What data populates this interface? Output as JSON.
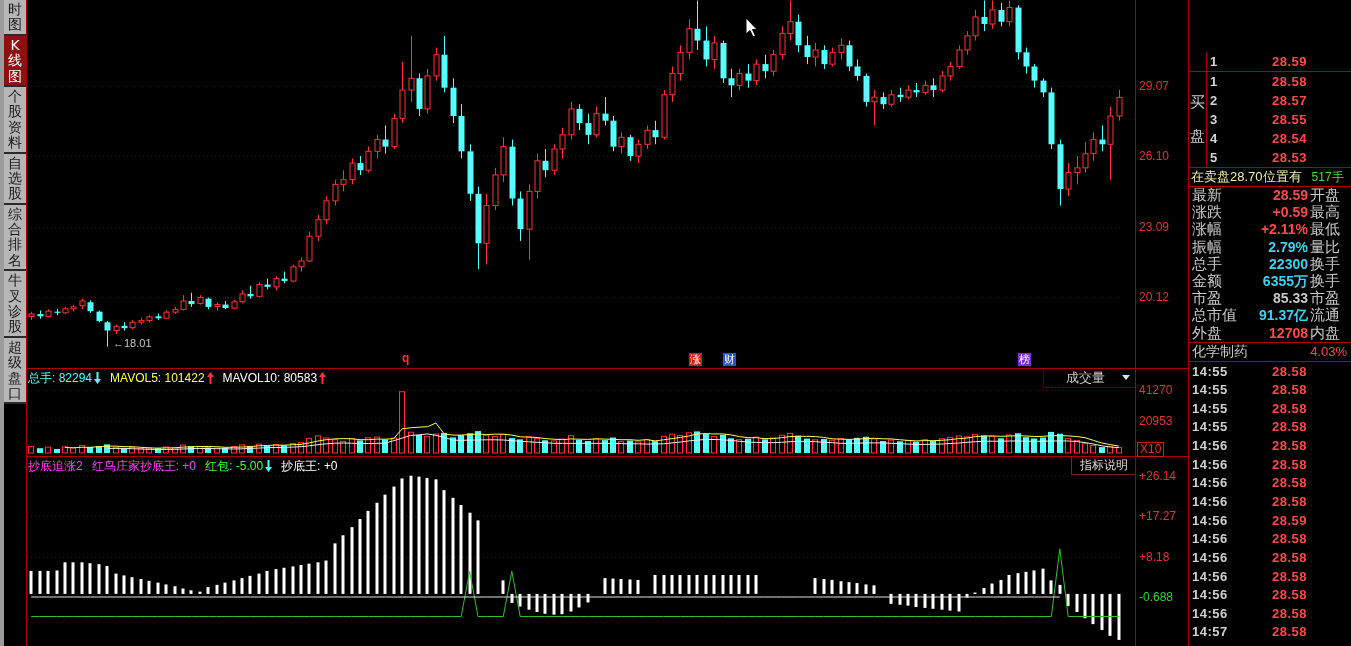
{
  "sidebar": {
    "tabs": [
      {
        "label": "时图",
        "selected": false
      },
      {
        "label": "K线图",
        "selected": true
      },
      {
        "label": "个股资料",
        "selected": false
      },
      {
        "label": "自选股",
        "selected": false
      },
      {
        "label": "综合排名",
        "selected": false
      },
      {
        "label": "牛叉诊股",
        "selected": false
      },
      {
        "label": "超级盘口",
        "selected": false
      }
    ]
  },
  "price_chart": {
    "chart_data": {
      "type": "candlestick",
      "grid": true,
      "ylim": [
        17.11,
        32.72
      ],
      "yticks": [
        {
          "value": 29.07,
          "label": "29.07"
        },
        {
          "value": 26.1,
          "label": "26.10"
        },
        {
          "value": 23.09,
          "label": "23.09"
        },
        {
          "value": 20.12,
          "label": "20.12"
        }
      ],
      "ohlc": [
        [
          19.3,
          19.5,
          19.15,
          19.4
        ],
        [
          19.4,
          19.55,
          19.2,
          19.3
        ],
        [
          19.3,
          19.6,
          19.25,
          19.52
        ],
        [
          19.5,
          19.62,
          19.35,
          19.45
        ],
        [
          19.45,
          19.7,
          19.4,
          19.62
        ],
        [
          19.62,
          19.8,
          19.5,
          19.7
        ],
        [
          19.75,
          20.05,
          19.6,
          19.95
        ],
        [
          19.9,
          19.98,
          19.45,
          19.52
        ],
        [
          19.5,
          19.55,
          19.05,
          19.1
        ],
        [
          19.05,
          19.1,
          18.01,
          18.7
        ],
        [
          18.7,
          18.95,
          18.55,
          18.88
        ],
        [
          18.9,
          19.05,
          18.7,
          18.8
        ],
        [
          18.82,
          19.15,
          18.75,
          19.05
        ],
        [
          19.05,
          19.25,
          18.95,
          19.12
        ],
        [
          19.12,
          19.35,
          19.05,
          19.28
        ],
        [
          19.3,
          19.42,
          19.15,
          19.22
        ],
        [
          19.22,
          19.55,
          19.18,
          19.48
        ],
        [
          19.48,
          19.7,
          19.4,
          19.6
        ],
        [
          19.6,
          20.2,
          19.55,
          19.95
        ],
        [
          19.95,
          20.3,
          19.7,
          19.82
        ],
        [
          19.85,
          20.2,
          19.8,
          20.1
        ],
        [
          20.05,
          20.1,
          19.6,
          19.7
        ],
        [
          19.72,
          19.9,
          19.55,
          19.8
        ],
        [
          19.8,
          19.95,
          19.6,
          19.65
        ],
        [
          19.65,
          20,
          19.6,
          19.92
        ],
        [
          19.92,
          20.4,
          19.85,
          20.25
        ],
        [
          20.25,
          20.6,
          20.05,
          20.15
        ],
        [
          20.15,
          20.75,
          20.1,
          20.65
        ],
        [
          20.65,
          20.9,
          20.45,
          20.55
        ],
        [
          20.55,
          21,
          20.4,
          20.9
        ],
        [
          20.9,
          21.2,
          20.7,
          20.8
        ],
        [
          20.8,
          21.5,
          20.75,
          21.4
        ],
        [
          21.4,
          21.8,
          21.2,
          21.65
        ],
        [
          21.65,
          22.9,
          21.6,
          22.7
        ],
        [
          22.7,
          23.6,
          22.5,
          23.4
        ],
        [
          23.4,
          24.4,
          23.2,
          24.2
        ],
        [
          24.2,
          25.1,
          24,
          24.9
        ],
        [
          24.9,
          25.5,
          24.6,
          25.1
        ],
        [
          25.1,
          26,
          24.9,
          25.8
        ],
        [
          25.8,
          26.1,
          25.3,
          25.5
        ],
        [
          25.5,
          26.5,
          25.4,
          26.3
        ],
        [
          26.3,
          27,
          26,
          26.8
        ],
        [
          26.8,
          27.4,
          26.2,
          26.5
        ],
        [
          26.5,
          27.9,
          26.4,
          27.7
        ],
        [
          27.7,
          30.1,
          27.5,
          28.9
        ],
        [
          28.9,
          31.2,
          28.4,
          29.4
        ],
        [
          29.4,
          29.6,
          27.8,
          28.1
        ],
        [
          28.1,
          29.8,
          27.9,
          29.5
        ],
        [
          29.5,
          30.7,
          29.3,
          30.4
        ],
        [
          30.4,
          31.2,
          28.8,
          29
        ],
        [
          29,
          29.4,
          27.5,
          27.8
        ],
        [
          27.8,
          28.3,
          26,
          26.3
        ],
        [
          26.3,
          26.6,
          24.2,
          24.5
        ],
        [
          24.5,
          24.8,
          21.3,
          22.4
        ],
        [
          22.4,
          24.5,
          21.5,
          24
        ],
        [
          24,
          25.6,
          23.8,
          25.3
        ],
        [
          25.3,
          26.9,
          25,
          26.5
        ],
        [
          26.5,
          26.8,
          24,
          24.3
        ],
        [
          24.3,
          24.6,
          22.5,
          23
        ],
        [
          23,
          24.9,
          21.7,
          24.6
        ],
        [
          24.6,
          26.2,
          24.3,
          25.9
        ],
        [
          25.9,
          26.4,
          25.2,
          25.5
        ],
        [
          25.5,
          26.6,
          25.3,
          26.4
        ],
        [
          26.4,
          27.3,
          26,
          27
        ],
        [
          27,
          28.4,
          26.8,
          28.1
        ],
        [
          28.1,
          28.3,
          27.2,
          27.5
        ],
        [
          27.5,
          27.9,
          26.6,
          27
        ],
        [
          27,
          28.2,
          26.9,
          27.9
        ],
        [
          27.9,
          28.6,
          27.4,
          27.6
        ],
        [
          27.6,
          27.8,
          26.3,
          26.5
        ],
        [
          26.5,
          27.1,
          26.2,
          26.9
        ],
        [
          26.9,
          27,
          25.9,
          26.1
        ],
        [
          26.1,
          26.8,
          25.8,
          26.6
        ],
        [
          26.6,
          27.4,
          26.4,
          27.2
        ],
        [
          27.2,
          27.6,
          26.6,
          26.9
        ],
        [
          26.9,
          28.9,
          26.8,
          28.7
        ],
        [
          28.7,
          29.9,
          28.4,
          29.6
        ],
        [
          29.6,
          30.8,
          29.3,
          30.5
        ],
        [
          30.5,
          31.9,
          30.2,
          31.5
        ],
        [
          31.5,
          32.7,
          30.6,
          31
        ],
        [
          31,
          31.6,
          29.9,
          30.2
        ],
        [
          30.2,
          31.2,
          29.8,
          30.9
        ],
        [
          30.9,
          31,
          29.2,
          29.4
        ],
        [
          29.4,
          29.8,
          28.6,
          29.1
        ],
        [
          29.1,
          29.8,
          28.9,
          29.6
        ],
        [
          29.6,
          30,
          29,
          29.3
        ],
        [
          29.3,
          30.2,
          29.1,
          30
        ],
        [
          30,
          30.4,
          29.4,
          29.7
        ],
        [
          29.7,
          30.6,
          29.5,
          30.4
        ],
        [
          30.4,
          31.6,
          30.2,
          31.3
        ],
        [
          31.3,
          32.7,
          31,
          31.8
        ],
        [
          31.8,
          32.1,
          30.5,
          30.8
        ],
        [
          30.8,
          31.2,
          30,
          30.3
        ],
        [
          30.3,
          30.9,
          29.9,
          30.6
        ],
        [
          30.6,
          30.8,
          29.8,
          30
        ],
        [
          30,
          30.7,
          29.9,
          30.5
        ],
        [
          30.5,
          31.1,
          30.2,
          30.8
        ],
        [
          30.8,
          31,
          29.7,
          29.9
        ],
        [
          29.9,
          30.2,
          29.3,
          29.5
        ],
        [
          29.5,
          29.6,
          28.2,
          28.4
        ],
        [
          28.4,
          28.9,
          27.4,
          28.6
        ],
        [
          28.6,
          28.8,
          28.1,
          28.3
        ],
        [
          28.3,
          28.9,
          28.2,
          28.7
        ],
        [
          28.7,
          29,
          28.4,
          28.6
        ],
        [
          28.6,
          29.1,
          28.5,
          28.9
        ],
        [
          28.9,
          29.2,
          28.6,
          28.8
        ],
        [
          28.8,
          29.3,
          28.7,
          29.1
        ],
        [
          29.1,
          29.4,
          28.6,
          28.9
        ],
        [
          28.9,
          29.7,
          28.8,
          29.5
        ],
        [
          29.5,
          30.1,
          29.3,
          29.9
        ],
        [
          29.9,
          30.8,
          29.8,
          30.6
        ],
        [
          30.6,
          31.4,
          30.4,
          31.2
        ],
        [
          31.2,
          32.3,
          31,
          32
        ],
        [
          32,
          32.7,
          31.4,
          31.7
        ],
        [
          31.7,
          32.7,
          31.5,
          32.3
        ],
        [
          32.3,
          32.6,
          31.6,
          31.8
        ],
        [
          31.8,
          32.7,
          31.6,
          32.4
        ],
        [
          32.4,
          32.5,
          30.2,
          30.5
        ],
        [
          30.5,
          30.7,
          29.6,
          29.9
        ],
        [
          29.9,
          30,
          29,
          29.3
        ],
        [
          29.3,
          29.4,
          28.6,
          28.8
        ],
        [
          28.8,
          29,
          26.4,
          26.6
        ],
        [
          26.6,
          26.8,
          24,
          24.7
        ],
        [
          24.7,
          25.8,
          24.4,
          25.4
        ],
        [
          25.4,
          26.1,
          24.9,
          25.6
        ],
        [
          25.6,
          26.7,
          25.4,
          26.2
        ],
        [
          26.2,
          27.1,
          25.9,
          26.8
        ],
        [
          26.8,
          27.4,
          26.3,
          26.6
        ],
        [
          26.6,
          28.2,
          25.1,
          27.8
        ],
        [
          27.8,
          28.9,
          27.6,
          28.59
        ]
      ]
    },
    "low_price_label": "←18.01",
    "event_markers": [
      {
        "kind": "letter",
        "label": "q",
        "color": "#ff3030"
      },
      {
        "kind": "badge",
        "label": "涨",
        "color": "#c81e1e"
      },
      {
        "kind": "badge",
        "label": "财",
        "color": "#2456c8"
      },
      {
        "kind": "badge",
        "label": "榜",
        "color": "#7a2cc8"
      }
    ]
  },
  "volume_panel": {
    "legend": [
      {
        "text": "总手: 82294",
        "color": "#54ffff",
        "rising": false
      },
      {
        "text": "MAVOL5: 101422",
        "color": "#ffff54",
        "rising": true
      },
      {
        "text": "MAVOL10: 80583",
        "color": "#ffffff",
        "rising": true
      }
    ],
    "indicator_menu": "成交量",
    "scale_badge": "X10",
    "chart_data": {
      "type": "bar",
      "stacked": true,
      "grid": true,
      "ylim": [
        -2000,
        55000
      ],
      "yticks": [
        41270,
        20953
      ],
      "series": [
        {
          "color": "#ff3232",
          "values": [
            4300,
            null,
            3800,
            null,
            4000,
            3300,
            4800,
            null,
            null,
            null,
            3700,
            null,
            3600,
            2800,
            3300,
            null,
            3900,
            3500,
            5200,
            null,
            4100,
            null,
            3200,
            null,
            4200,
            5300,
            null,
            5800,
            null,
            5400,
            null,
            6200,
            6800,
            9600,
            11200,
            9800,
            8700,
            7600,
            9300,
            null,
            9900,
            10400,
            null,
            9700,
            40100,
            13600,
            null,
            10900,
            12400,
            null,
            null,
            null,
            null,
            null,
            11600,
            10800,
            12100,
            null,
            null,
            10600,
            9400,
            null,
            7900,
            9100,
            11300,
            null,
            null,
            9200,
            null,
            null,
            7400,
            null,
            7300,
            8800,
            null,
            10900,
            12300,
            11400,
            13200,
            null,
            null,
            10700,
            null,
            null,
            8700,
            null,
            10400,
            null,
            9800,
            11600,
            12800,
            null,
            null,
            8600,
            null,
            8300,
            9500,
            null,
            null,
            null,
            9200,
            null,
            8400,
            null,
            8200,
            null,
            8700,
            null,
            9300,
            10200,
            11100,
            10500,
            12200,
            null,
            10800,
            null,
            11700,
            null,
            null,
            null,
            null,
            null,
            null,
            9400,
            8200,
            6100,
            4900,
            null,
            4400,
            3500
          ]
        },
        {
          "color": "#54ffff",
          "values": [
            null,
            3100,
            null,
            2600,
            null,
            null,
            null,
            3900,
            4500,
            5600,
            null,
            3000,
            null,
            null,
            null,
            3100,
            null,
            null,
            null,
            4400,
            null,
            3600,
            null,
            3400,
            null,
            null,
            4600,
            null,
            4700,
            null,
            5000,
            null,
            null,
            null,
            null,
            null,
            null,
            null,
            null,
            8200,
            null,
            null,
            8800,
            null,
            null,
            null,
            11800,
            null,
            null,
            13100,
            10200,
            11700,
            12900,
            14300,
            null,
            null,
            null,
            9700,
            8900,
            null,
            null,
            8300,
            null,
            null,
            null,
            8600,
            7800,
            null,
            8400,
            10100,
            null,
            8100,
            null,
            null,
            7700,
            null,
            null,
            null,
            null,
            14100,
            12600,
            null,
            11900,
            9600,
            null,
            9300,
            null,
            8900,
            null,
            null,
            null,
            11300,
            9400,
            null,
            9100,
            null,
            null,
            8800,
            9900,
            10600,
            null,
            7800,
            null,
            7600,
            null,
            7400,
            null,
            7900,
            null,
            null,
            null,
            null,
            null,
            11400,
            null,
            9600,
            null,
            12900,
            10300,
            9500,
            10100,
            13800,
            12600,
            null,
            null,
            null,
            null,
            3800,
            null,
            null
          ]
        },
        {
          "type": "line",
          "color": "#ffff54",
          "values": [
            null,
            null,
            null,
            null,
            3600,
            3400,
            3700,
            3700,
            4100,
            4400,
            4500,
            4100,
            4100,
            3700,
            3300,
            3200,
            3300,
            3300,
            3800,
            4000,
            4200,
            4200,
            4100,
            3700,
            3700,
            3900,
            4100,
            4700,
            4900,
            5200,
            5100,
            5400,
            5600,
            6600,
            7800,
            8700,
            9200,
            9400,
            9300,
            8700,
            8700,
            9100,
            9000,
            9400,
            15800,
            16500,
            16900,
            17200,
            19600,
            12400,
            11700,
            11700,
            12100,
            12400,
            12100,
            12300,
            12300,
            11700,
            10600,
            10400,
            10100,
            9400,
            9000,
            8700,
            9200,
            9000,
            8900,
            9200,
            9100,
            8900,
            8700,
            8700,
            8300,
            8700,
            7900,
            8600,
            9400,
            10200,
            11100,
            12400,
            12700,
            12400,
            12500,
            11800,
            10700,
            10000,
            10000,
            9400,
            9400,
            10000,
            10700,
            10900,
            10900,
            10700,
            10200,
            9300,
            9000,
            8900,
            9100,
            9400,
            9600,
            9300,
            9200,
            8700,
            8200,
            7900,
            8100,
            8000,
            8300,
            8700,
            9400,
            9800,
            10700,
            11100,
            11200,
            10900,
            11100,
            11300,
            11100,
            10800,
            10900,
            11300,
            11300,
            11200,
            10800,
            10000,
            8200,
            6500,
            5500,
            4500
          ]
        },
        {
          "type": "line",
          "color": "#f0f0f0",
          "values": [
            null,
            null,
            null,
            null,
            null,
            null,
            null,
            null,
            null,
            3000,
            3000,
            3000,
            2800,
            2600,
            2400,
            2300,
            2300,
            2400,
            2600,
            2800,
            2900,
            2900,
            2800,
            2700,
            2600,
            2700,
            3000,
            3200,
            3500,
            3500,
            3700,
            3800,
            4100,
            4700,
            5400,
            6000,
            6400,
            6500,
            6400,
            6200,
            6200,
            6300,
            6400,
            8000,
            9700,
            11500,
            11800,
            12500,
            11500,
            10200,
            8400,
            8300,
            8400,
            8500,
            8600,
            8600,
            8500,
            8100,
            7600,
            7300,
            7000,
            6700,
            6300,
            6300,
            6300,
            6300,
            6300,
            6300,
            6300,
            6200,
            6100,
            6000,
            6000,
            5800,
            5900,
            6000,
            6600,
            7200,
            7900,
            8400,
            8800,
            8800,
            8600,
            8200,
            7600,
            7200,
            6900,
            6700,
            6700,
            7000,
            7400,
            7600,
            7600,
            7400,
            7000,
            6700,
            6300,
            6300,
            6400,
            6600,
            6600,
            6600,
            6300,
            6100,
            5800,
            5600,
            5600,
            5700,
            5800,
            6200,
            6500,
            7000,
            7400,
            7700,
            7700,
            7700,
            7800,
            7800,
            7700,
            7700,
            7700,
            7800,
            7900,
            7800,
            7500,
            6800,
            5800,
            4700,
            3900,
            3500
          ]
        }
      ]
    }
  },
  "indicator_panel": {
    "name": "抄底追涨2",
    "legend": [
      {
        "text": "红鸟庄家抄底王: +0",
        "color": "#ff44ff"
      },
      {
        "text": "红包: -5.00",
        "color": "#44ff44",
        "rising": false
      },
      {
        "text": "抄底王: +0",
        "color": "#ffffff"
      }
    ],
    "help_button": "指标说明",
    "chart_data": {
      "type": "bar",
      "grid": true,
      "ylim": [
        -11.55,
        30.35
      ],
      "yticks": [
        {
          "value": 26.14,
          "label": "+26.14"
        },
        {
          "value": 17.27,
          "label": "+17.27"
        },
        {
          "value": 8.18,
          "label": "+8.18"
        },
        {
          "value": -0.688,
          "label": "-0.688"
        }
      ],
      "series": [
        {
          "color": "#ffffff",
          "values": [
            5.1,
            5.1,
            5.1,
            5.2,
            7,
            7,
            7,
            6.8,
            6.6,
            6.2,
            4.5,
            4.1,
            3.7,
            3.3,
            2.9,
            2.5,
            2.1,
            1.7,
            1.2,
            0.8,
            0.5,
            1.5,
            2,
            2.5,
            3,
            3.5,
            4,
            4.5,
            5.1,
            5.5,
            5.8,
            6.1,
            6.4,
            6.7,
            7,
            7.4,
            11.2,
            13,
            14.8,
            16.6,
            18.4,
            20.2,
            22,
            23.8,
            25.6,
            26.2,
            26,
            25.7,
            25.4,
            23,
            21.3,
            19.7,
            18,
            16.3,
            null,
            null,
            3,
            -2,
            -2.8,
            -3.5,
            -4,
            -4.4,
            -4.6,
            -4.5,
            -3.9,
            -3,
            -1.9,
            null,
            3.5,
            3.4,
            3.3,
            3.2,
            3.1,
            null,
            4.2,
            4.2,
            4.2,
            4.2,
            4.2,
            4.2,
            4.2,
            4.2,
            4.2,
            4.2,
            4.2,
            4.2,
            4.2,
            null,
            null,
            null,
            null,
            null,
            null,
            3.5,
            3.3,
            3.1,
            2.8,
            2.6,
            2.4,
            2.1,
            1.9,
            null,
            -2.2,
            -2.4,
            -2.6,
            -2.9,
            -3.1,
            -3.3,
            -3.5,
            -3.7,
            -3.9,
            -0.8,
            0.3,
            1.3,
            2.3,
            3.1,
            4.2,
            4.6,
            4.9,
            5.2,
            5.6,
            3,
            2,
            -2.7,
            -4,
            -5.4,
            -6.7,
            -8,
            -9.3,
            -10.2
          ]
        },
        {
          "type": "line",
          "color": "#30c030",
          "values": [
            -5,
            -5,
            -5,
            -5,
            -5,
            -5,
            -5,
            -5,
            -5,
            -5,
            -5,
            -5,
            -5,
            -5,
            -5,
            -5,
            -5,
            -5,
            -5,
            -5,
            -5,
            -5,
            -5,
            -5,
            -5,
            -5,
            -5,
            -5,
            -5,
            -5,
            -5,
            -5,
            -5,
            -5,
            -5,
            -5,
            -5,
            -5,
            -5,
            -5,
            -5,
            -5,
            -5,
            -5,
            -5,
            -5,
            -5,
            -5,
            -5,
            -5,
            -5,
            -5,
            5,
            -5,
            -5,
            -5,
            -5,
            5,
            -5,
            -5,
            -5,
            -5,
            -5,
            -5,
            -5,
            -5,
            -5,
            -5,
            -5,
            -5,
            -5,
            -5,
            -5,
            -5,
            -5,
            -5,
            -5,
            -5,
            -5,
            -5,
            -5,
            -5,
            -5,
            -5,
            -5,
            -5,
            -5,
            -5,
            -5,
            -5,
            -5,
            -5,
            -5,
            -5,
            -5,
            -5,
            -5,
            -5,
            -5,
            -5,
            -5,
            -5,
            -5,
            -5,
            -5,
            -5,
            -5,
            -5,
            -5,
            -5,
            -5,
            -5,
            -5,
            -5,
            -5,
            -5,
            -5,
            -5,
            -5,
            -5,
            -5,
            -5,
            10,
            -5,
            -5,
            -5,
            -5,
            -5,
            -5,
            -5
          ]
        },
        {
          "type": "line",
          "color": "#e0e0e0",
          "values": [
            -0.688,
            -0.688,
            -0.688,
            -0.688,
            -0.688,
            -0.688,
            -0.688,
            -0.688,
            -0.688,
            -0.688,
            -0.688,
            -0.688,
            -0.688,
            -0.688,
            -0.688,
            -0.688,
            -0.688,
            -0.688,
            -0.688,
            -0.688,
            -0.688,
            -0.688,
            -0.688,
            -0.688,
            -0.688,
            -0.688,
            -0.688,
            -0.688,
            -0.688,
            -0.688,
            -0.688,
            -0.688,
            -0.688,
            -0.688,
            -0.688,
            -0.688,
            -0.688,
            -0.688,
            -0.688,
            -0.688,
            -0.688,
            -0.688,
            -0.688,
            -0.688,
            -0.688,
            -0.688,
            -0.688,
            -0.688,
            -0.688,
            -0.688,
            -0.688,
            -0.688,
            -0.688,
            -0.688,
            -0.688,
            -0.688,
            -0.688,
            -0.688,
            -0.688,
            -0.688,
            -0.688,
            -0.688,
            -0.688,
            -0.688,
            -0.688,
            -0.688,
            -0.688,
            -0.688,
            -0.688,
            -0.688,
            -0.688,
            -0.688,
            -0.688,
            -0.688,
            -0.688,
            -0.688,
            -0.688,
            -0.688,
            -0.688,
            -0.688,
            -0.688,
            -0.688,
            -0.688,
            -0.688,
            -0.688,
            -0.688,
            -0.688,
            -0.688,
            -0.688,
            -0.688,
            -0.688,
            -0.688,
            -0.688,
            -0.688,
            -0.688,
            -0.688,
            -0.688,
            -0.688,
            -0.688,
            -0.688,
            -0.688,
            -0.688,
            -0.688,
            -0.688,
            -0.688,
            -0.688,
            -0.688,
            -0.688,
            -0.688,
            -0.688,
            -0.688,
            -0.688,
            -0.688,
            -0.688,
            -0.688,
            -0.688,
            -0.688,
            -0.688,
            -0.688,
            -0.688,
            -0.688,
            -0.688,
            -0.688,
            null,
            null,
            null,
            null,
            null,
            null,
            null
          ]
        }
      ]
    }
  },
  "quote_panel": {
    "asks": [
      {
        "rank": "1",
        "price": "28.59"
      }
    ],
    "bid_title": "买盘",
    "bids": [
      {
        "rank": "1",
        "price": "28.58"
      },
      {
        "rank": "2",
        "price": "28.57"
      },
      {
        "rank": "3",
        "price": "28.55"
      },
      {
        "rank": "4",
        "price": "28.54"
      },
      {
        "rank": "5",
        "price": "28.53"
      }
    ],
    "order_notice": {
      "text": "在卖盘28.70位置有",
      "volume": "517手"
    },
    "stats": [
      {
        "label": "最新",
        "value": "28.59",
        "color": "#ff4848",
        "label_2": "开盘"
      },
      {
        "label": "涨跌",
        "value": "+0.59",
        "color": "#ff4848",
        "label_2": "最高"
      },
      {
        "label": "涨幅",
        "value": "+2.11%",
        "color": "#ff4848",
        "label_2": "最低"
      },
      {
        "label": "振幅",
        "value": "2.79%",
        "color": "#40d0f0",
        "label_2": "量比"
      },
      {
        "label": "总手",
        "value": "22300",
        "color": "#40d0f0",
        "label_2": "换手"
      },
      {
        "label": "金额",
        "value": "6355万",
        "color": "#40d0f0",
        "label_2": "换手"
      },
      {
        "label": "市盈",
        "value": "85.33",
        "color": "#c8c8c8",
        "label_2": "市盈"
      },
      {
        "label": "总市值",
        "value": "91.37亿",
        "color": "#40d0f0",
        "label_2": "流通"
      },
      {
        "label": "外盘",
        "value": "12708",
        "color": "#ff4848",
        "label_2": "内盘"
      }
    ],
    "sector": {
      "name": "化学制药",
      "change": "4.03%"
    },
    "trades": [
      {
        "time": "14:55",
        "price": "28.58"
      },
      {
        "time": "14:55",
        "price": "28.58"
      },
      {
        "time": "14:55",
        "price": "28.58"
      },
      {
        "time": "14:55",
        "price": "28.58"
      },
      {
        "time": "14:56",
        "price": "28.58"
      },
      {
        "time": "14:56",
        "price": "28.58"
      },
      {
        "time": "14:56",
        "price": "28.58"
      },
      {
        "time": "14:56",
        "price": "28.58"
      },
      {
        "time": "14:56",
        "price": "28.59"
      },
      {
        "time": "14:56",
        "price": "28.58"
      },
      {
        "time": "14:56",
        "price": "28.58"
      },
      {
        "time": "14:56",
        "price": "28.58"
      },
      {
        "time": "14:56",
        "price": "28.58"
      },
      {
        "time": "14:56",
        "price": "28.58"
      },
      {
        "time": "14:57",
        "price": "28.58"
      }
    ]
  }
}
